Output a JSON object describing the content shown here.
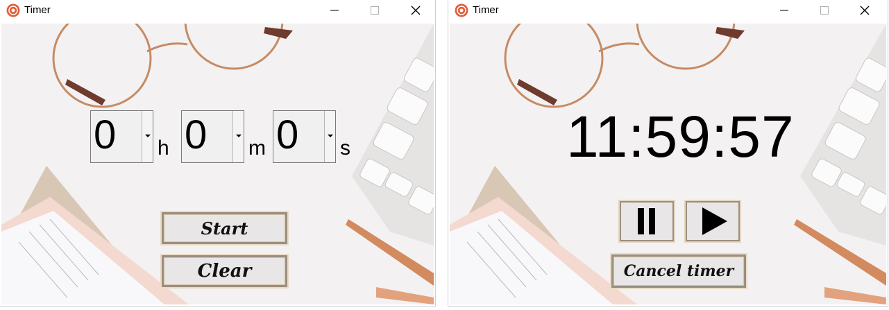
{
  "windows": [
    {
      "title": "Timer",
      "spinboxes": [
        {
          "value": "0",
          "unit": "h"
        },
        {
          "value": "0",
          "unit": "m"
        },
        {
          "value": "0",
          "unit": "s"
        }
      ],
      "buttons": {
        "start": "Start",
        "clear": "Clear"
      }
    },
    {
      "title": "Timer",
      "countdown": "11:59:57",
      "buttons": {
        "pause_icon": "pause-icon",
        "play_icon": "play-icon",
        "cancel": "Cancel timer"
      }
    }
  ],
  "title_controls": [
    "minimize-icon",
    "maximize-icon",
    "close-icon"
  ],
  "colors": {
    "text": "#000000",
    "button_face": "#e8e6e6",
    "button_border": "#9a8f7f",
    "background": "#f3f1f2"
  }
}
